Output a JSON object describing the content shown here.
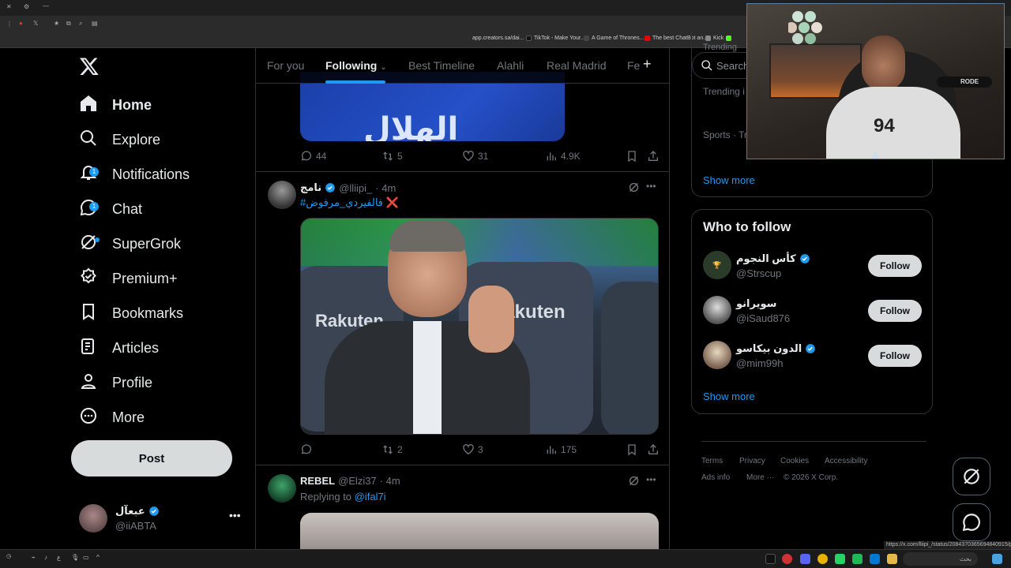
{
  "browser": {
    "bookmarks": [
      {
        "label": "app.creators.sa/dai...",
        "color": "#3a3a3a"
      },
      {
        "label": "TikTok - Make Your...",
        "color": "#111111"
      },
      {
        "label": "A Game of Thrones...",
        "color": "#444444"
      },
      {
        "label": "The best ChatBot an...",
        "color": "#e00000"
      },
      {
        "label": "Kick",
        "color": "#53fc18"
      }
    ]
  },
  "nav": {
    "items": [
      {
        "label": "Home",
        "icon": "home-icon",
        "active": true
      },
      {
        "label": "Explore",
        "icon": "search-icon"
      },
      {
        "label": "Notifications",
        "icon": "bell-icon",
        "badge": "1"
      },
      {
        "label": "Chat",
        "icon": "chat-icon",
        "badge": "1"
      },
      {
        "label": "SuperGrok",
        "icon": "grok-icon",
        "dot": true
      },
      {
        "label": "Premium+",
        "icon": "premium-icon"
      },
      {
        "label": "Bookmarks",
        "icon": "bookmark-icon"
      },
      {
        "label": "Articles",
        "icon": "articles-icon"
      },
      {
        "label": "Profile",
        "icon": "profile-icon"
      },
      {
        "label": "More",
        "icon": "more-circle-icon"
      }
    ],
    "post_label": "Post",
    "account": {
      "name": "عبعآل",
      "handle": "@iiABTA"
    }
  },
  "tabs": [
    {
      "label": "For you"
    },
    {
      "label": "Following",
      "active": true
    },
    {
      "label": "Best Timeline"
    },
    {
      "label": "Alahli"
    },
    {
      "label": "Real Madrid"
    },
    {
      "label": "Fe"
    }
  ],
  "feed": {
    "top_tweet": {
      "image_text": "الهلال",
      "replies": "44",
      "reposts": "5",
      "likes": "31",
      "views": "4.9K"
    },
    "tweet1": {
      "name": "نامج",
      "handle": "@lliipi_",
      "time": "· 4m",
      "text": "#فالفيردي_مرفوض ❌",
      "image_text_left": "Rakuten",
      "image_text_right": "Rakuten",
      "replies": "",
      "reposts": "2",
      "likes": "3",
      "views": "175"
    },
    "tweet2": {
      "name": "REBEL",
      "handle": "@Elzi37",
      "time": "· 4m",
      "replying_prefix": "Replying to",
      "replying_to": "@ifal7i"
    }
  },
  "right": {
    "search_placeholder": "Search",
    "trending_header": "Trending",
    "trending_label": "Trending i",
    "sports_label": "Sports · Tr",
    "show_more_1": "Show more",
    "wtf_title": "Who to follow",
    "wtf": [
      {
        "name": "كأس النجوم",
        "handle": "@Strscup",
        "verified": true,
        "follow": "Follow"
      },
      {
        "name": "سويرانو",
        "handle": "@iSaud876",
        "verified": false,
        "follow": "Follow"
      },
      {
        "name": "الدون بيكاسو",
        "handle": "@mim99h",
        "verified": true,
        "follow": "Follow"
      }
    ],
    "show_more_2": "Show more",
    "footer": [
      "Terms",
      "Privacy",
      "Cookies",
      "Accessibility",
      "Ads info",
      "More ···",
      "© 2026 X Corp."
    ]
  },
  "status": {
    "url": "https://x.com/lliipi_/status/2084370365694840915/photo/1",
    "taskbar_search": "بحث"
  },
  "webcam": {
    "mic_brand": "RODE",
    "jersey_number": "94"
  },
  "colors": {
    "accent": "#1d9bf0",
    "background": "#000000",
    "border": "#2f3336",
    "muted": "#71767b"
  }
}
